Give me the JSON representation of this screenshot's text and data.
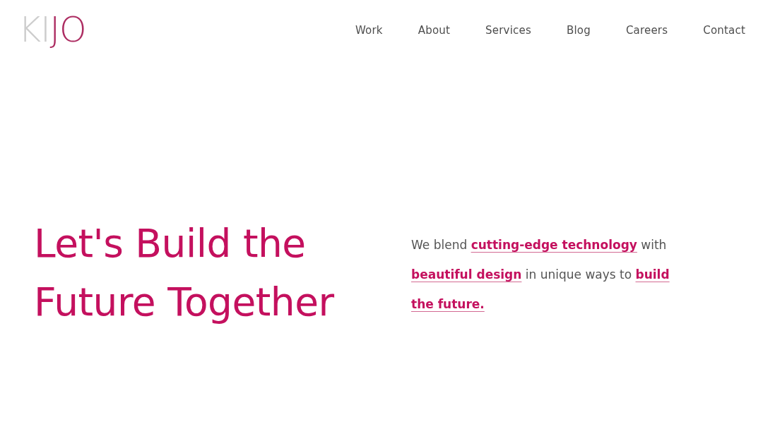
{
  "header": {
    "logo": [
      {
        "text": "KI",
        "kind": "light"
      },
      {
        "text": "JO",
        "kind": "accent"
      }
    ],
    "nav": [
      "Work",
      "About",
      "Services",
      "Blog",
      "Careers",
      "Contact"
    ]
  },
  "hero": {
    "heading": "Let's Build the Future Together",
    "intro": [
      {
        "text": "We blend ",
        "kind": "plain"
      },
      {
        "text": "cutting-edge technology",
        "kind": "link"
      },
      {
        "text": " with ",
        "kind": "plain"
      },
      {
        "text": "beautiful design",
        "kind": "link"
      },
      {
        "text": " in unique ways to ",
        "kind": "plain"
      },
      {
        "text": "build",
        "kind": "link"
      },
      {
        "text": "the future.",
        "kind": "link"
      }
    ]
  }
}
